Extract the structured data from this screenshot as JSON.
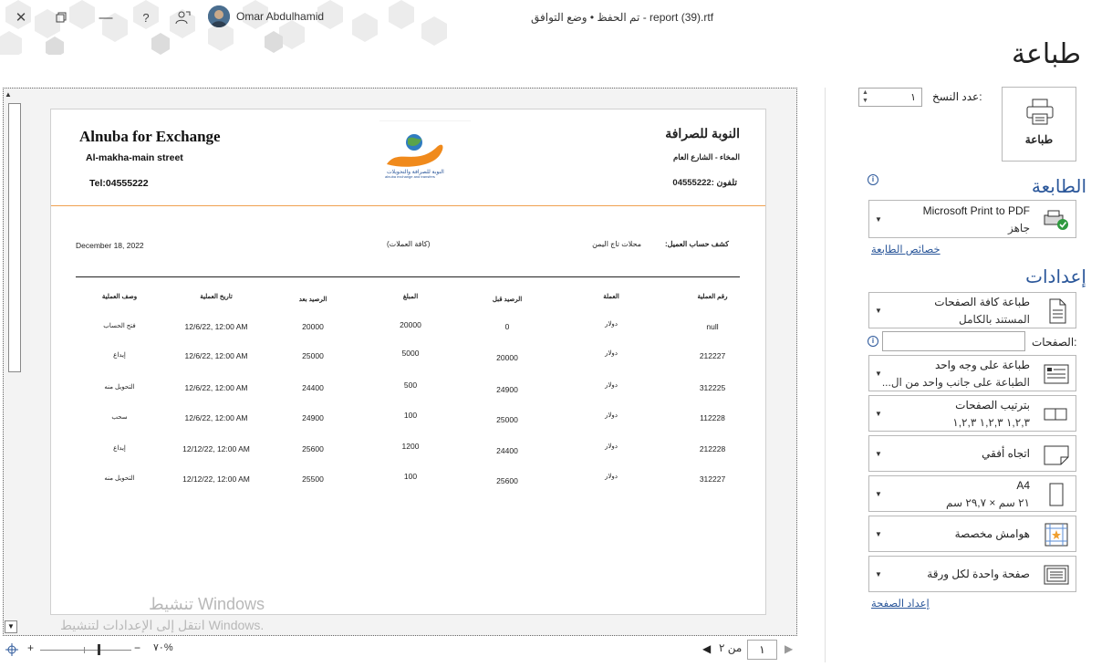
{
  "window": {
    "title": "report (39).rtf",
    "compat": "وضع التوافق",
    "saved": "تم الحفظ",
    "user": "Omar Abdulhamid"
  },
  "panel": {
    "title": "طباعة",
    "print_button": "طباعة",
    "copies_label": "عدد النسخ:",
    "copies_value": "١",
    "printer_section": "الطابعة",
    "printer_name": "Microsoft Print to PDF",
    "printer_status": "جاهز",
    "printer_props_link": "خصائص الطابعة",
    "settings_section": "إعدادات",
    "pages_label": "الصفحات:",
    "pages_value": "",
    "options": [
      {
        "l1": "طباعة كافة الصفحات",
        "l2": "المستند بالكامل",
        "icon": "document-icon"
      },
      {
        "l1": "طباعة على وجه واحد",
        "l2": "الطباعة على جانب واحد من ال...",
        "icon": "single-side-icon"
      },
      {
        "l1": "بترتيب الصفحات",
        "l2": "١,٢,٣   ١,٢,٣   ١,٢,٣",
        "icon": "collate-icon"
      },
      {
        "l1": "اتجاه أفقي",
        "l2": "",
        "icon": "landscape-icon"
      },
      {
        "l1": "A4",
        "l2": "٢١ سم × ٢٩,٧ سم",
        "icon": "paper-size-icon"
      },
      {
        "l1": "هوامش مخصصة",
        "l2": "",
        "icon": "margins-icon"
      },
      {
        "l1": "صفحة واحدة لكل ورقة",
        "l2": "",
        "icon": "pages-per-sheet-icon"
      }
    ],
    "page_setup_link": "إعداد الصفحة"
  },
  "report": {
    "company_en": "Alnuba for Exchange",
    "street_en": "Al-makha-main street",
    "tel_en": "Tel:04555222",
    "company_ar": "النوبة للصرافة",
    "street_ar": "المخاء - الشارع العام",
    "tel_ar": "تلفون :04555222",
    "statement_label": "كشف حساب العميل:",
    "customer": "محلات تاج اليمن",
    "currencies": "(كافة العملات)",
    "date": "December 18, 2022",
    "columns": [
      "رقم العملية",
      "العملة",
      "الرصيد قبل",
      "المبلغ",
      "الرصيد بعد",
      "تاريخ العملية",
      "وصف العملية"
    ],
    "rows": [
      {
        "id": "null",
        "cur": "دولار",
        "before": "0",
        "amount": "20000",
        "after": "20000",
        "date": "12/6/22, 12:00 AM",
        "desc": "فتح الحساب"
      },
      {
        "id": "212227",
        "cur": "دولار",
        "before": "20000",
        "amount": "5000",
        "after": "25000",
        "date": "12/6/22, 12:00 AM",
        "desc": "إيداع"
      },
      {
        "id": "312225",
        "cur": "دولار",
        "before": "24900",
        "amount": "500",
        "after": "24400",
        "date": "12/6/22, 12:00 AM",
        "desc": "التحويل منه"
      },
      {
        "id": "112228",
        "cur": "دولار",
        "before": "25000",
        "amount": "100",
        "after": "24900",
        "date": "12/6/22, 12:00 AM",
        "desc": "سحب"
      },
      {
        "id": "212228",
        "cur": "دولار",
        "before": "24400",
        "amount": "1200",
        "after": "25600",
        "date": "12/12/22, 12:00 AM",
        "desc": "إيداع"
      },
      {
        "id": "312227",
        "cur": "دولار",
        "before": "25600",
        "amount": "100",
        "after": "25500",
        "date": "12/12/22, 12:00 AM",
        "desc": "التحويل منه"
      }
    ]
  },
  "bottom": {
    "page_current": "١",
    "page_of": "من ٢",
    "zoom": "٧٠%"
  },
  "watermark": {
    "line1": "تنشيط Windows",
    "line2": "انتقل إلى الإعدادات لتنشيط Windows."
  },
  "colors": {
    "accent": "#2b579a",
    "header_line": "#f0a050"
  }
}
